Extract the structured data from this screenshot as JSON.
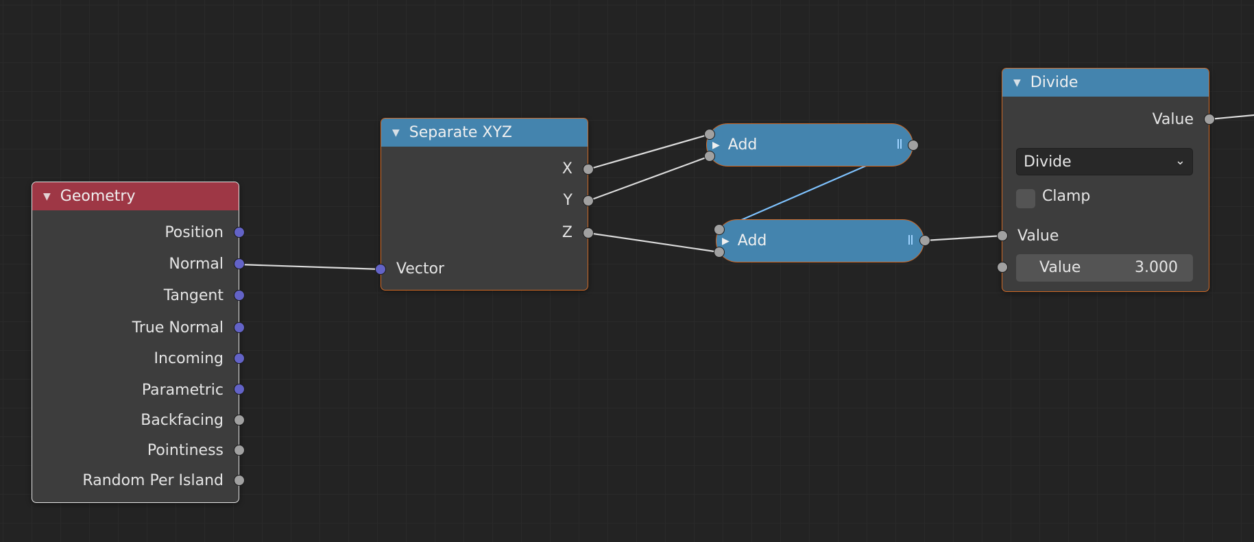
{
  "nodes": {
    "geometry": {
      "title": "Geometry",
      "outputs": [
        "Position",
        "Normal",
        "Tangent",
        "True Normal",
        "Incoming",
        "Parametric",
        "Backfacing",
        "Pointiness",
        "Random Per Island"
      ]
    },
    "separate_xyz": {
      "title": "Separate XYZ",
      "outputs": [
        "X",
        "Y",
        "Z"
      ],
      "input": "Vector"
    },
    "add_top": {
      "title": "Add"
    },
    "add_bottom": {
      "title": "Add"
    },
    "divide": {
      "title": "Divide",
      "output": "Value",
      "operation": "Divide",
      "clamp_label": "Clamp",
      "clamp_checked": false,
      "input_label": "Value",
      "value_field": {
        "label": "Value",
        "value": "3.000"
      }
    }
  },
  "colors": {
    "vector_socket": "#6363c7",
    "float_socket": "#a1a1a1",
    "header_blue": "#4484ae",
    "header_red": "#9e3745",
    "selected_outline": "#d26a26"
  }
}
